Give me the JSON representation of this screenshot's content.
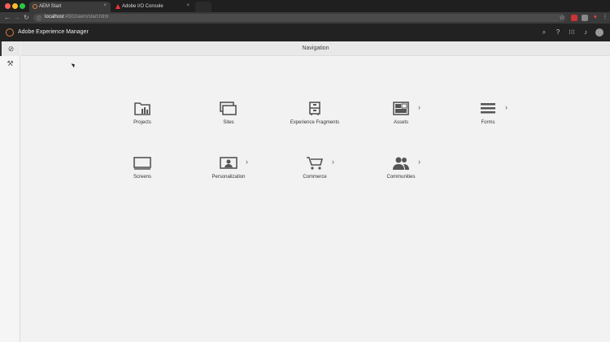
{
  "browser": {
    "tabs": [
      {
        "label": "AEM Start",
        "active": true
      },
      {
        "label": "Adobe I/O Console",
        "active": false
      }
    ],
    "url_host": "localhost",
    "url_path": ":4502/aem/start.html"
  },
  "shell": {
    "title": "Adobe Experience Manager"
  },
  "page": {
    "title": "Navigation"
  },
  "tiles": [
    {
      "label": "Projects"
    },
    {
      "label": "Sites"
    },
    {
      "label": "Experience Fragments"
    },
    {
      "label": "Assets"
    },
    {
      "label": "Forms"
    },
    {
      "label": "Screens"
    },
    {
      "label": "Personalization"
    },
    {
      "label": "Commerce"
    },
    {
      "label": "Communities"
    }
  ],
  "colors": {
    "shell_bg": "#222222",
    "brand_accent": "#e08040",
    "icon_gray": "#555555"
  }
}
